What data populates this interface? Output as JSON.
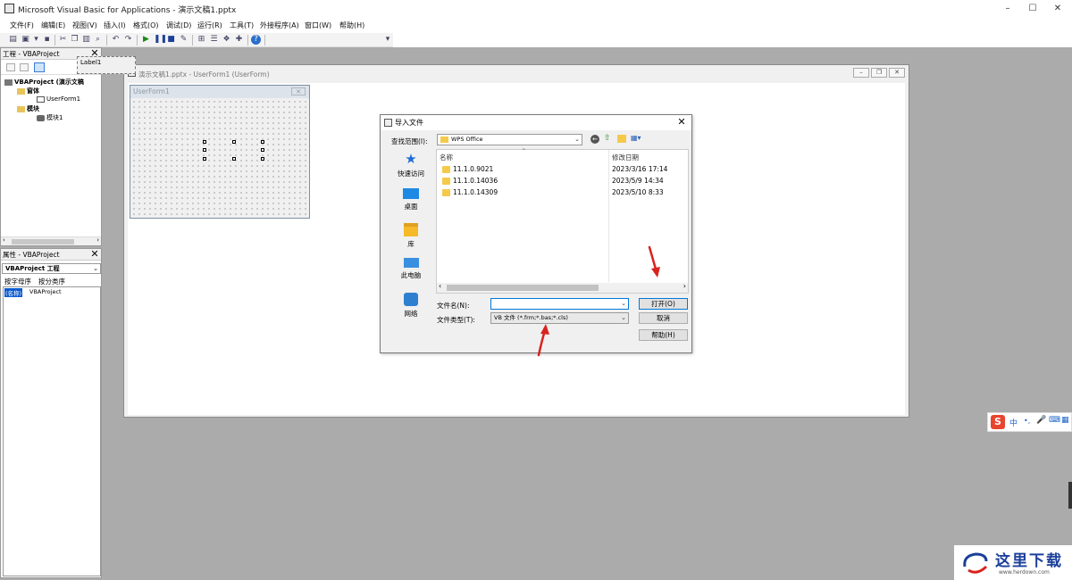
{
  "window": {
    "title": "Microsoft Visual Basic for Applications - 演示文稿1.pptx",
    "controls": [
      "–",
      "☐",
      "✕"
    ]
  },
  "menubar": [
    "文件(F)",
    "编辑(E)",
    "视图(V)",
    "插入(I)",
    "格式(O)",
    "调试(D)",
    "运行(R)",
    "工具(T)",
    "外接程序(A)",
    "窗口(W)",
    "帮助(H)"
  ],
  "project_pane": {
    "title": "工程 - VBAProject",
    "root": "VBAProject (演示文稿",
    "forms_folder": "窗体",
    "userform": "UserForm1",
    "modules_folder": "模块",
    "module": "模块1"
  },
  "properties_pane": {
    "title": "属性 - VBAProject",
    "object_combo": "VBAProject 工程",
    "tab_alpha": "按字母序",
    "tab_category": "按分类序",
    "prop_name": "(名称)",
    "prop_value": "VBAProject"
  },
  "mdi_window": {
    "title": "演示文稿1.pptx - UserForm1 (UserForm)"
  },
  "userform": {
    "title": "UserForm1",
    "label": "Label1"
  },
  "dialog": {
    "title": "导入文件",
    "lookin_label": "查找范围(I):",
    "lookin_value": "WPS Office",
    "places": [
      "快速访问",
      "桌面",
      "库",
      "此电脑",
      "网络"
    ],
    "columns": [
      "名称",
      "修改日期"
    ],
    "files": [
      {
        "name": "11.1.0.9021",
        "date": "2023/3/16 17:14"
      },
      {
        "name": "11.1.0.14036",
        "date": "2023/5/9 14:34"
      },
      {
        "name": "11.1.0.14309",
        "date": "2023/5/10 8:33"
      }
    ],
    "filename_label": "文件名(N):",
    "filename_value": "",
    "filetype_label": "文件类型(T):",
    "filetype_value": "VB 文件 (*.frm;*.bas;*.cls)",
    "open_button": "打开(O)",
    "cancel_button": "取消",
    "help_button": "帮助(H)"
  },
  "ime_bar": {
    "logo": "S",
    "mode": "中"
  },
  "watermark": {
    "text": "这里下载",
    "url": "www.herdown.com"
  },
  "colors": {
    "accent_blue": "#0078d7",
    "folder_yellow": "#f5c94a",
    "arrow_red": "#d8231f",
    "workspace_gray": "#ababab"
  }
}
